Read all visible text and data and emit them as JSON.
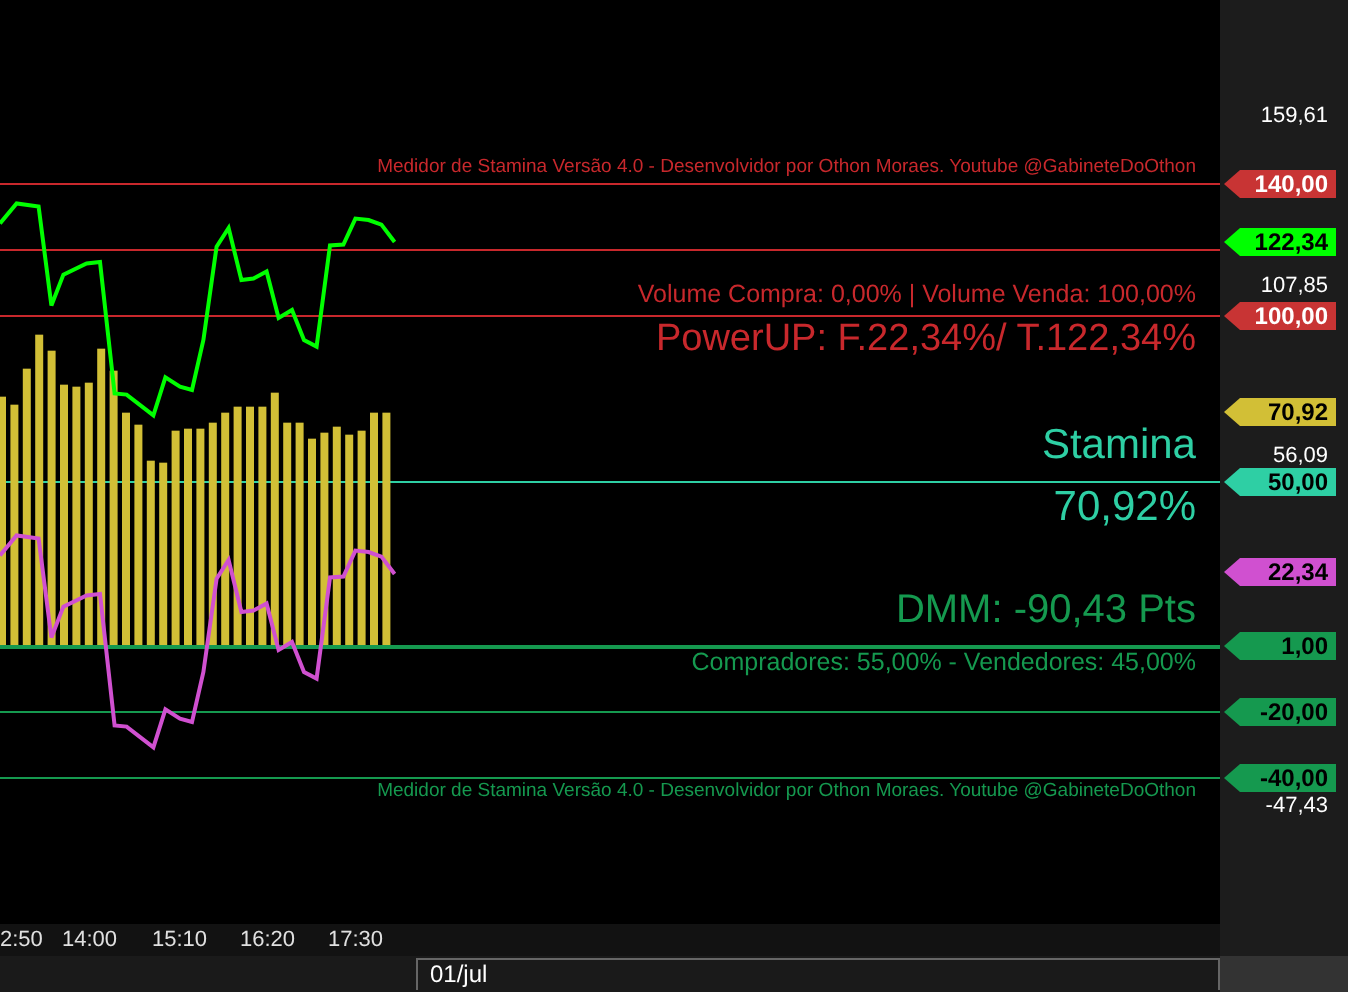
{
  "chart": {
    "watermark_top": "Medidor de Stamina Versão 4.0 - Desenvolvidor por Othon Moraes. Youtube @GabineteDoOthon",
    "volume": "Volume Compra: 0,00% | Volume Venda: 100,00%",
    "powerup": "PowerUP: F.22,34%/ T.122,34%",
    "stamina_label": "Stamina",
    "stamina_value": "70,92%",
    "dmm": "DMM: -90,43 Pts",
    "participants": "Compradores: 55,00% - Vendedores: 45,00%",
    "watermark_bottom": "Medidor de Stamina Versão 4.0 - Desenvolvidor por Othon Moraes. Youtube @GabineteDoOthon"
  },
  "price_axis": [
    {
      "kind": "label",
      "text": "159,61"
    },
    {
      "kind": "tag",
      "text": "140,00",
      "color": "#c83434"
    },
    {
      "kind": "tag",
      "text": "122,34",
      "color": "#00ff00"
    },
    {
      "kind": "label",
      "text": "107,85"
    },
    {
      "kind": "tag",
      "text": "100,00",
      "color": "#c83434"
    },
    {
      "kind": "tag",
      "text": "70,92",
      "color": "#d2bf36"
    },
    {
      "kind": "label",
      "text": "56,09"
    },
    {
      "kind": "tag",
      "text": "50,00",
      "color": "#2ecfa4"
    },
    {
      "kind": "tag",
      "text": "22,34",
      "color": "#d050d0"
    },
    {
      "kind": "tag",
      "text": "1,00",
      "color": "#15994f"
    },
    {
      "kind": "tag",
      "text": "-20,00",
      "color": "#15994f"
    },
    {
      "kind": "tag",
      "text": "-40,00",
      "color": "#15994f"
    },
    {
      "kind": "label",
      "text": "-47,43"
    }
  ],
  "time_axis": [
    "2:50",
    "14:00",
    "15:10",
    "16:20",
    "17:30"
  ],
  "date_bar": "01/jul"
}
